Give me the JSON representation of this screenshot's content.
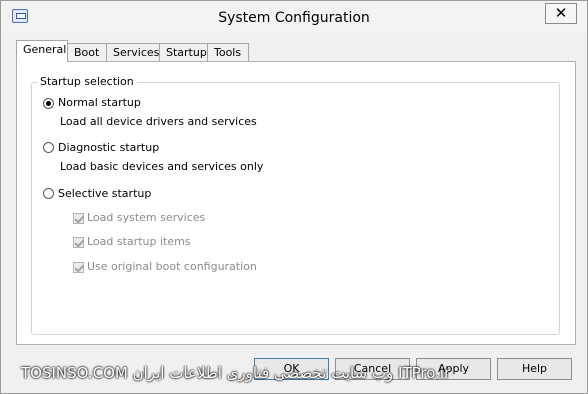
{
  "window": {
    "title": "System Configuration",
    "close_glyph": "✕"
  },
  "tabs": [
    {
      "label": "General",
      "active": true
    },
    {
      "label": "Boot",
      "active": false
    },
    {
      "label": "Services",
      "active": false
    },
    {
      "label": "Startup",
      "active": false
    },
    {
      "label": "Tools",
      "active": false
    }
  ],
  "startup": {
    "group_label": "Startup selection",
    "normal": {
      "label": "Normal startup",
      "description": "Load all device drivers and services",
      "selected": true
    },
    "diagnostic": {
      "label": "Diagnostic startup",
      "description": "Load basic devices and services only",
      "selected": false
    },
    "selective": {
      "label": "Selective startup",
      "selected": false,
      "options": [
        {
          "label": "Load system services",
          "checked": true,
          "enabled": false
        },
        {
          "label": "Load startup items",
          "checked": true,
          "enabled": false
        },
        {
          "label": "Use original boot configuration",
          "checked": true,
          "enabled": false
        }
      ]
    }
  },
  "buttons": {
    "ok": "OK",
    "cancel": "Cancel",
    "apply": "Apply",
    "help": "Help"
  },
  "watermark": "TOSINSO.COM وب سایت تخصصی فناوری اطلاعات ایران ITPro.ir"
}
